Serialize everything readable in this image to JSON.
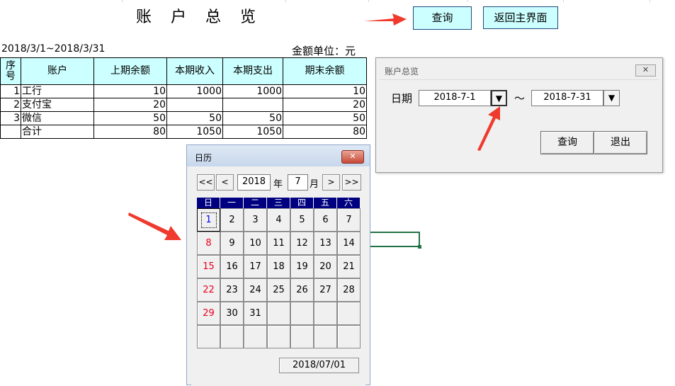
{
  "sheet": {
    "title": "账 户 总 览",
    "query_button": "查询",
    "return_button": "返回主界面",
    "date_range": "2018/3/1~2018/3/31",
    "amount_unit": "金额单位：元",
    "table": {
      "headers": [
        "序号",
        "账户",
        "上期余额",
        "本期收入",
        "本期支出",
        "期末余额"
      ],
      "rows": [
        [
          "1",
          "工行",
          "10",
          "1000",
          "1000",
          "10"
        ],
        [
          "2",
          "支付宝",
          "20",
          "",
          "",
          "20"
        ],
        [
          "3",
          "微信",
          "50",
          "50",
          "50",
          "50"
        ],
        [
          "",
          "合计",
          "80",
          "1050",
          "1050",
          "80"
        ]
      ]
    }
  },
  "query_dialog": {
    "title": "账户总览",
    "close": "✕",
    "date_label": "日期",
    "start_date": "2018-7-1",
    "end_date": "2018-7-31",
    "tilde": "～",
    "dropdown_glyph": "▼",
    "query_button": "查询",
    "exit_button": "退出"
  },
  "calendar": {
    "title": "日历",
    "close": "✕",
    "nav": {
      "prev_year": "<<",
      "prev_month": "<",
      "next_month": ">",
      "next_year": ">>"
    },
    "year": "2018",
    "year_label": "年",
    "month": "7",
    "month_label": "月",
    "weekdays": [
      "日",
      "一",
      "二",
      "三",
      "四",
      "五",
      "六"
    ],
    "weeks": [
      [
        "1",
        "2",
        "3",
        "4",
        "5",
        "6",
        "7"
      ],
      [
        "8",
        "9",
        "10",
        "11",
        "12",
        "13",
        "14"
      ],
      [
        "15",
        "16",
        "17",
        "18",
        "19",
        "20",
        "21"
      ],
      [
        "22",
        "23",
        "24",
        "25",
        "26",
        "27",
        "28"
      ],
      [
        "29",
        "30",
        "31",
        "",
        "",
        "",
        ""
      ],
      [
        "",
        "",
        "",
        "",
        "",
        "",
        ""
      ]
    ],
    "selected_day": "1",
    "selected_date": "2018/07/01"
  },
  "colors": {
    "header_fill": "#ccffff",
    "weekday_header": "#000080",
    "sunday_text": "#e8001c",
    "selected_text": "#0000ff",
    "annotation_arrow": "#ef3a2d",
    "cell_selection": "#217346"
  },
  "icons": {
    "annotation": "red-arrow-icon"
  }
}
